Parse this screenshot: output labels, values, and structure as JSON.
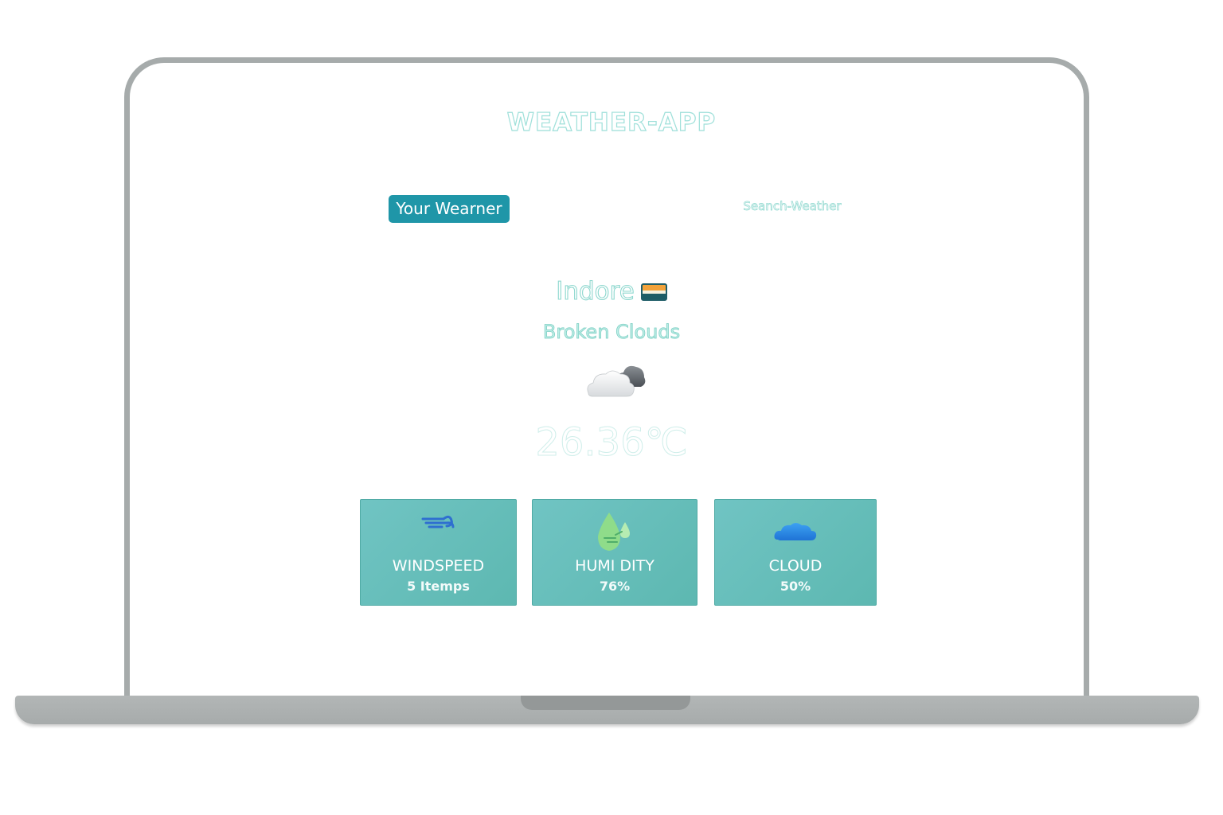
{
  "app": {
    "title": "WEATHER-APP"
  },
  "tabs": {
    "your_weather": "Your Wearner",
    "search_weather": "Seanch-Weather"
  },
  "weather": {
    "city": "Indore",
    "flag_icon": "country-flag-icon",
    "description": "Broken Clouds",
    "condition_icon": "broken-clouds-icon",
    "temperature": "26.36℃"
  },
  "stats": [
    {
      "icon": "wind-icon",
      "label": "WINDSPEED",
      "value": "5 Itemps"
    },
    {
      "icon": "humidity-drop-icon",
      "label": "HUMI DITY",
      "value": "76%"
    },
    {
      "icon": "cloud-icon",
      "label": "CLOUD",
      "value": "50%"
    }
  ],
  "colors": {
    "accent": "#1f96a8",
    "card": "#66bdb9",
    "title_outline": "#9fe0da",
    "frame": "#a6abab"
  }
}
